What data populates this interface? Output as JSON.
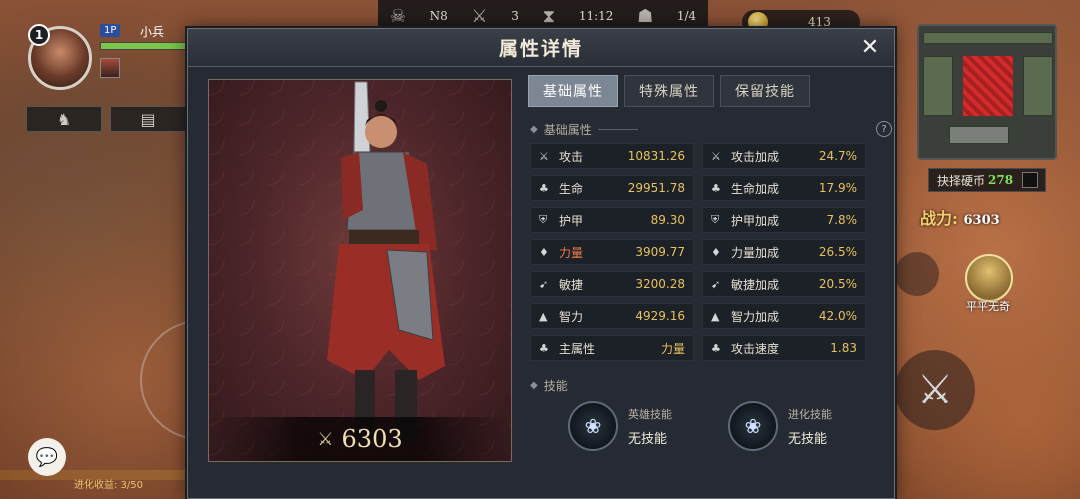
{
  "hud": {
    "map_code": "N8",
    "kills": "3",
    "time": "11:12",
    "wave": "1/4",
    "gold": "413"
  },
  "player": {
    "level": "1",
    "tag": "1P",
    "name": "小兵",
    "hp_fraction": 0.95
  },
  "right": {
    "exchange_label": "抉择硬币",
    "exchange_value": "278",
    "power_label": "战力:",
    "power_value": "6303",
    "ally_name": "平平无奇"
  },
  "footer": {
    "evolution": "进化收益: 3/50"
  },
  "dialog": {
    "title": "属性详情",
    "close": "✕",
    "hero_power": "6303",
    "tabs": [
      {
        "label": "基础属性",
        "active": true
      },
      {
        "label": "特殊属性",
        "active": false
      },
      {
        "label": "保留技能",
        "active": false
      }
    ],
    "section_basic": "基础属性",
    "section_skills": "技能",
    "stats": [
      {
        "icon": "sword-icon",
        "name": "攻击",
        "value": "10831.26"
      },
      {
        "icon": "sword-up-icon",
        "name": "攻击加成",
        "value": "24.7%"
      },
      {
        "icon": "life-icon",
        "name": "生命",
        "value": "29951.78"
      },
      {
        "icon": "life-up-icon",
        "name": "生命加成",
        "value": "17.9%"
      },
      {
        "icon": "armor-icon",
        "name": "护甲",
        "value": "89.30"
      },
      {
        "icon": "armor-up-icon",
        "name": "护甲加成",
        "value": "7.8%"
      },
      {
        "icon": "strength-icon",
        "name": "力量",
        "value": "3909.77"
      },
      {
        "icon": "strength-up-icon",
        "name": "力量加成",
        "value": "26.5%"
      },
      {
        "icon": "agility-icon",
        "name": "敏捷",
        "value": "3200.28"
      },
      {
        "icon": "agility-up-icon",
        "name": "敏捷加成",
        "value": "20.5%"
      },
      {
        "icon": "intellect-icon",
        "name": "智力",
        "value": "4929.16"
      },
      {
        "icon": "intellect-up-icon",
        "name": "智力加成",
        "value": "42.0%"
      },
      {
        "icon": "main-attr-icon",
        "name": "主属性",
        "value": "力量"
      },
      {
        "icon": "attack-speed-icon",
        "name": "攻击速度",
        "value": "1.83"
      }
    ],
    "skills": [
      {
        "label": "英雄技能",
        "value": "无技能"
      },
      {
        "label": "进化技能",
        "value": "无技能"
      }
    ]
  }
}
